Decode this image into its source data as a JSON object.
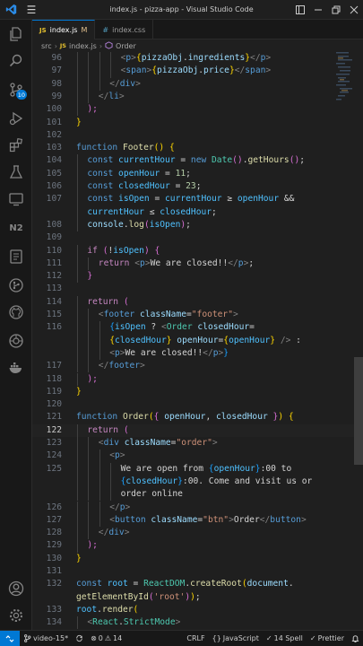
{
  "window": {
    "title": "index.js - pizza-app - Visual Studio Code"
  },
  "tabs": [
    {
      "icon": "JS",
      "label": "index.js",
      "modified": "M",
      "active": true
    },
    {
      "icon": "#",
      "label": "index.css",
      "active": false
    }
  ],
  "breadcrumb": [
    "src",
    "index.js",
    "Order"
  ],
  "activity": {
    "scm_badge": "10"
  },
  "status": {
    "branch": "video-15*",
    "errors": "0",
    "warnings": "14",
    "line_ending": "CRLF",
    "language": "JavaScript",
    "spell": "14 Spell",
    "formatter": "Prettier"
  },
  "code_lines": [
    {
      "n": "96",
      "indent": 4,
      "tokens": [
        [
          "<",
          "brk"
        ],
        [
          "p",
          "tag"
        ],
        [
          ">",
          "brk"
        ],
        [
          "{",
          "b1"
        ],
        [
          "pizzaObj",
          "v"
        ],
        [
          ".",
          "p"
        ],
        [
          "ingredients",
          "v"
        ],
        [
          "}",
          "b1"
        ],
        [
          "</",
          "brk"
        ],
        [
          "p",
          "tag"
        ],
        [
          ">",
          "brk"
        ]
      ]
    },
    {
      "n": "97",
      "indent": 4,
      "tokens": [
        [
          "<",
          "brk"
        ],
        [
          "span",
          "tag"
        ],
        [
          ">",
          "brk"
        ],
        [
          "{",
          "b1"
        ],
        [
          "pizzaObj",
          "v"
        ],
        [
          ".",
          "p"
        ],
        [
          "price",
          "v"
        ],
        [
          "}",
          "b1"
        ],
        [
          "</",
          "brk"
        ],
        [
          "span",
          "tag"
        ],
        [
          ">",
          "brk"
        ]
      ]
    },
    {
      "n": "98",
      "indent": 3,
      "tokens": [
        [
          "</",
          "brk"
        ],
        [
          "div",
          "tag"
        ],
        [
          ">",
          "brk"
        ]
      ]
    },
    {
      "n": "99",
      "indent": 2,
      "tokens": [
        [
          "</",
          "brk"
        ],
        [
          "li",
          "tag"
        ],
        [
          ">",
          "brk"
        ]
      ]
    },
    {
      "n": "100",
      "indent": 1,
      "tokens": [
        [
          ");",
          "b2"
        ]
      ]
    },
    {
      "n": "101",
      "indent": 0,
      "tokens": [
        [
          "}",
          "b1"
        ]
      ]
    },
    {
      "n": "102",
      "indent": 0,
      "tokens": []
    },
    {
      "n": "103",
      "indent": 0,
      "tokens": [
        [
          "function ",
          "k"
        ],
        [
          "Footer",
          "f"
        ],
        [
          "() ",
          "b1"
        ],
        [
          "{",
          "b1"
        ]
      ]
    },
    {
      "n": "104",
      "indent": 1,
      "tokens": [
        [
          "const ",
          "k"
        ],
        [
          "currentHour",
          "c"
        ],
        [
          " = ",
          "p"
        ],
        [
          "new ",
          "k"
        ],
        [
          "Date",
          "cls"
        ],
        [
          "()",
          "b2"
        ],
        [
          ".",
          "p"
        ],
        [
          "getHours",
          "f"
        ],
        [
          "()",
          "b2"
        ],
        [
          ";",
          "p"
        ]
      ]
    },
    {
      "n": "105",
      "indent": 1,
      "tokens": [
        [
          "const ",
          "k"
        ],
        [
          "openHour",
          "c"
        ],
        [
          " = ",
          "p"
        ],
        [
          "11",
          "n"
        ],
        [
          ";",
          "p"
        ]
      ]
    },
    {
      "n": "106",
      "indent": 1,
      "tokens": [
        [
          "const ",
          "k"
        ],
        [
          "closedHour",
          "c"
        ],
        [
          " = ",
          "p"
        ],
        [
          "23",
          "n"
        ],
        [
          ";",
          "p"
        ]
      ]
    },
    {
      "n": "107",
      "indent": 1,
      "tokens": [
        [
          "const ",
          "k"
        ],
        [
          "isOpen",
          "c"
        ],
        [
          " = ",
          "p"
        ],
        [
          "currentHour",
          "c"
        ],
        [
          " ≥ ",
          "p"
        ],
        [
          "openHour",
          "c"
        ],
        [
          " &&",
          "p"
        ]
      ]
    },
    {
      "n": "",
      "indent": 1,
      "tokens": [
        [
          "currentHour",
          "c"
        ],
        [
          " ≤ ",
          "p"
        ],
        [
          "closedHour",
          "c"
        ],
        [
          ";",
          "p"
        ]
      ]
    },
    {
      "n": "108",
      "indent": 1,
      "tokens": [
        [
          "console",
          "v"
        ],
        [
          ".",
          "p"
        ],
        [
          "log",
          "f"
        ],
        [
          "(",
          "b2"
        ],
        [
          "isOpen",
          "c"
        ],
        [
          ")",
          "b2"
        ],
        [
          ";",
          "p"
        ]
      ]
    },
    {
      "n": "109",
      "indent": 0,
      "tokens": []
    },
    {
      "n": "110",
      "indent": 1,
      "tokens": [
        [
          "if ",
          "kc"
        ],
        [
          "(",
          "b2"
        ],
        [
          "!",
          "p"
        ],
        [
          "isOpen",
          "c"
        ],
        [
          ") ",
          "b2"
        ],
        [
          "{",
          "b2"
        ]
      ]
    },
    {
      "n": "111",
      "indent": 2,
      "tokens": [
        [
          "return ",
          "kc"
        ],
        [
          "<",
          "brk"
        ],
        [
          "p",
          "tag"
        ],
        [
          ">",
          "brk"
        ],
        [
          "We are closed!!",
          "txt"
        ],
        [
          "</",
          "brk"
        ],
        [
          "p",
          "tag"
        ],
        [
          ">",
          "brk"
        ],
        [
          ";",
          "p"
        ]
      ]
    },
    {
      "n": "112",
      "indent": 1,
      "tokens": [
        [
          "}",
          "b2"
        ]
      ]
    },
    {
      "n": "113",
      "indent": 0,
      "tokens": []
    },
    {
      "n": "114",
      "indent": 1,
      "tokens": [
        [
          "return ",
          "kc"
        ],
        [
          "(",
          "b2"
        ]
      ]
    },
    {
      "n": "115",
      "indent": 2,
      "tokens": [
        [
          "<",
          "brk"
        ],
        [
          "footer ",
          "tag"
        ],
        [
          "className",
          "v"
        ],
        [
          "=",
          "p"
        ],
        [
          "\"footer\"",
          "s"
        ],
        [
          ">",
          "brk"
        ]
      ]
    },
    {
      "n": "116",
      "indent": 3,
      "tokens": [
        [
          "{",
          "b3"
        ],
        [
          "isOpen",
          "c"
        ],
        [
          " ? ",
          "p"
        ],
        [
          "<",
          "brk"
        ],
        [
          "Order ",
          "cls"
        ],
        [
          "closedHour",
          "v"
        ],
        [
          "=",
          "p"
        ]
      ]
    },
    {
      "n": "",
      "indent": 3,
      "tokens": [
        [
          "{",
          "b1"
        ],
        [
          "closedHour",
          "c"
        ],
        [
          "}",
          "b1"
        ],
        [
          " openHour",
          "v"
        ],
        [
          "=",
          "p"
        ],
        [
          "{",
          "b1"
        ],
        [
          "openHour",
          "c"
        ],
        [
          "}",
          "b1"
        ],
        [
          " ",
          "p"
        ],
        [
          "/>",
          "brk"
        ],
        [
          " :",
          "p"
        ]
      ]
    },
    {
      "n": "",
      "indent": 3,
      "tokens": [
        [
          "<",
          "brk"
        ],
        [
          "p",
          "tag"
        ],
        [
          ">",
          "brk"
        ],
        [
          "We are closed!!",
          "txt"
        ],
        [
          "</",
          "brk"
        ],
        [
          "p",
          "tag"
        ],
        [
          ">",
          "brk"
        ],
        [
          "}",
          "b3"
        ]
      ]
    },
    {
      "n": "117",
      "indent": 2,
      "tokens": [
        [
          "</",
          "brk"
        ],
        [
          "footer",
          "tag"
        ],
        [
          ">",
          "brk"
        ]
      ]
    },
    {
      "n": "118",
      "indent": 1,
      "tokens": [
        [
          ");",
          "b2"
        ]
      ]
    },
    {
      "n": "119",
      "indent": 0,
      "tokens": [
        [
          "}",
          "b1"
        ]
      ]
    },
    {
      "n": "120",
      "indent": 0,
      "tokens": []
    },
    {
      "n": "121",
      "indent": 0,
      "tokens": [
        [
          "function ",
          "k"
        ],
        [
          "Order",
          "f"
        ],
        [
          "(",
          "b1"
        ],
        [
          "{ ",
          "b2"
        ],
        [
          "openHour",
          "v"
        ],
        [
          ", ",
          "p"
        ],
        [
          "closedHour",
          "v"
        ],
        [
          " }",
          "b2"
        ],
        [
          ") ",
          "b1"
        ],
        [
          "{",
          "b1"
        ]
      ]
    },
    {
      "n": "122",
      "indent": 1,
      "current": true,
      "tokens": [
        [
          "return ",
          "kc"
        ],
        [
          "(",
          "b2"
        ]
      ]
    },
    {
      "n": "123",
      "indent": 2,
      "tokens": [
        [
          "<",
          "brk"
        ],
        [
          "div ",
          "tag"
        ],
        [
          "className",
          "v"
        ],
        [
          "=",
          "p"
        ],
        [
          "\"order\"",
          "s"
        ],
        [
          ">",
          "brk"
        ]
      ]
    },
    {
      "n": "124",
      "indent": 3,
      "tokens": [
        [
          "<",
          "brk"
        ],
        [
          "p",
          "tag"
        ],
        [
          ">",
          "brk"
        ]
      ]
    },
    {
      "n": "125",
      "indent": 4,
      "tokens": [
        [
          "We are open from ",
          "txt"
        ],
        [
          "{",
          "b3"
        ],
        [
          "openHour",
          "c"
        ],
        [
          "}",
          "b3"
        ],
        [
          ":00 to",
          "txt"
        ]
      ]
    },
    {
      "n": "",
      "indent": 4,
      "tokens": [
        [
          "{",
          "b3"
        ],
        [
          "closedHour",
          "c"
        ],
        [
          "}",
          "b3"
        ],
        [
          ":00. Come and visit us or",
          "txt"
        ]
      ]
    },
    {
      "n": "",
      "indent": 4,
      "tokens": [
        [
          "order online",
          "txt"
        ]
      ]
    },
    {
      "n": "126",
      "indent": 3,
      "tokens": [
        [
          "</",
          "brk"
        ],
        [
          "p",
          "tag"
        ],
        [
          ">",
          "brk"
        ]
      ]
    },
    {
      "n": "127",
      "indent": 3,
      "tokens": [
        [
          "<",
          "brk"
        ],
        [
          "button ",
          "tag"
        ],
        [
          "className",
          "v"
        ],
        [
          "=",
          "p"
        ],
        [
          "\"btn\"",
          "s"
        ],
        [
          ">",
          "brk"
        ],
        [
          "Order",
          "txt"
        ],
        [
          "</",
          "brk"
        ],
        [
          "button",
          "tag"
        ],
        [
          ">",
          "brk"
        ]
      ]
    },
    {
      "n": "128",
      "indent": 2,
      "tokens": [
        [
          "</",
          "brk"
        ],
        [
          "div",
          "tag"
        ],
        [
          ">",
          "brk"
        ]
      ]
    },
    {
      "n": "129",
      "indent": 1,
      "tokens": [
        [
          ");",
          "b2"
        ]
      ]
    },
    {
      "n": "130",
      "indent": 0,
      "tokens": [
        [
          "}",
          "b1"
        ]
      ]
    },
    {
      "n": "131",
      "indent": 0,
      "tokens": []
    },
    {
      "n": "132",
      "indent": 0,
      "tokens": [
        [
          "const ",
          "k"
        ],
        [
          "root",
          "c"
        ],
        [
          " = ",
          "p"
        ],
        [
          "ReactDOM",
          "cls"
        ],
        [
          ".",
          "p"
        ],
        [
          "createRoot",
          "f"
        ],
        [
          "(",
          "b1"
        ],
        [
          "document",
          "v"
        ],
        [
          ".",
          "p"
        ]
      ]
    },
    {
      "n": "",
      "indent": 0,
      "tokens": [
        [
          "getElementById",
          "f"
        ],
        [
          "(",
          "b2"
        ],
        [
          "'root'",
          "s"
        ],
        [
          ")",
          "b2"
        ],
        [
          ")",
          "b1"
        ],
        [
          ";",
          "p"
        ]
      ]
    },
    {
      "n": "133",
      "indent": 0,
      "tokens": [
        [
          "root",
          "c"
        ],
        [
          ".",
          "p"
        ],
        [
          "render",
          "f"
        ],
        [
          "(",
          "b1"
        ]
      ]
    },
    {
      "n": "134",
      "indent": 1,
      "tokens": [
        [
          "<",
          "brk"
        ],
        [
          "React",
          "cls"
        ],
        [
          ".",
          "p"
        ],
        [
          "StrictMode",
          "cls"
        ],
        [
          ">",
          "brk"
        ]
      ]
    }
  ]
}
